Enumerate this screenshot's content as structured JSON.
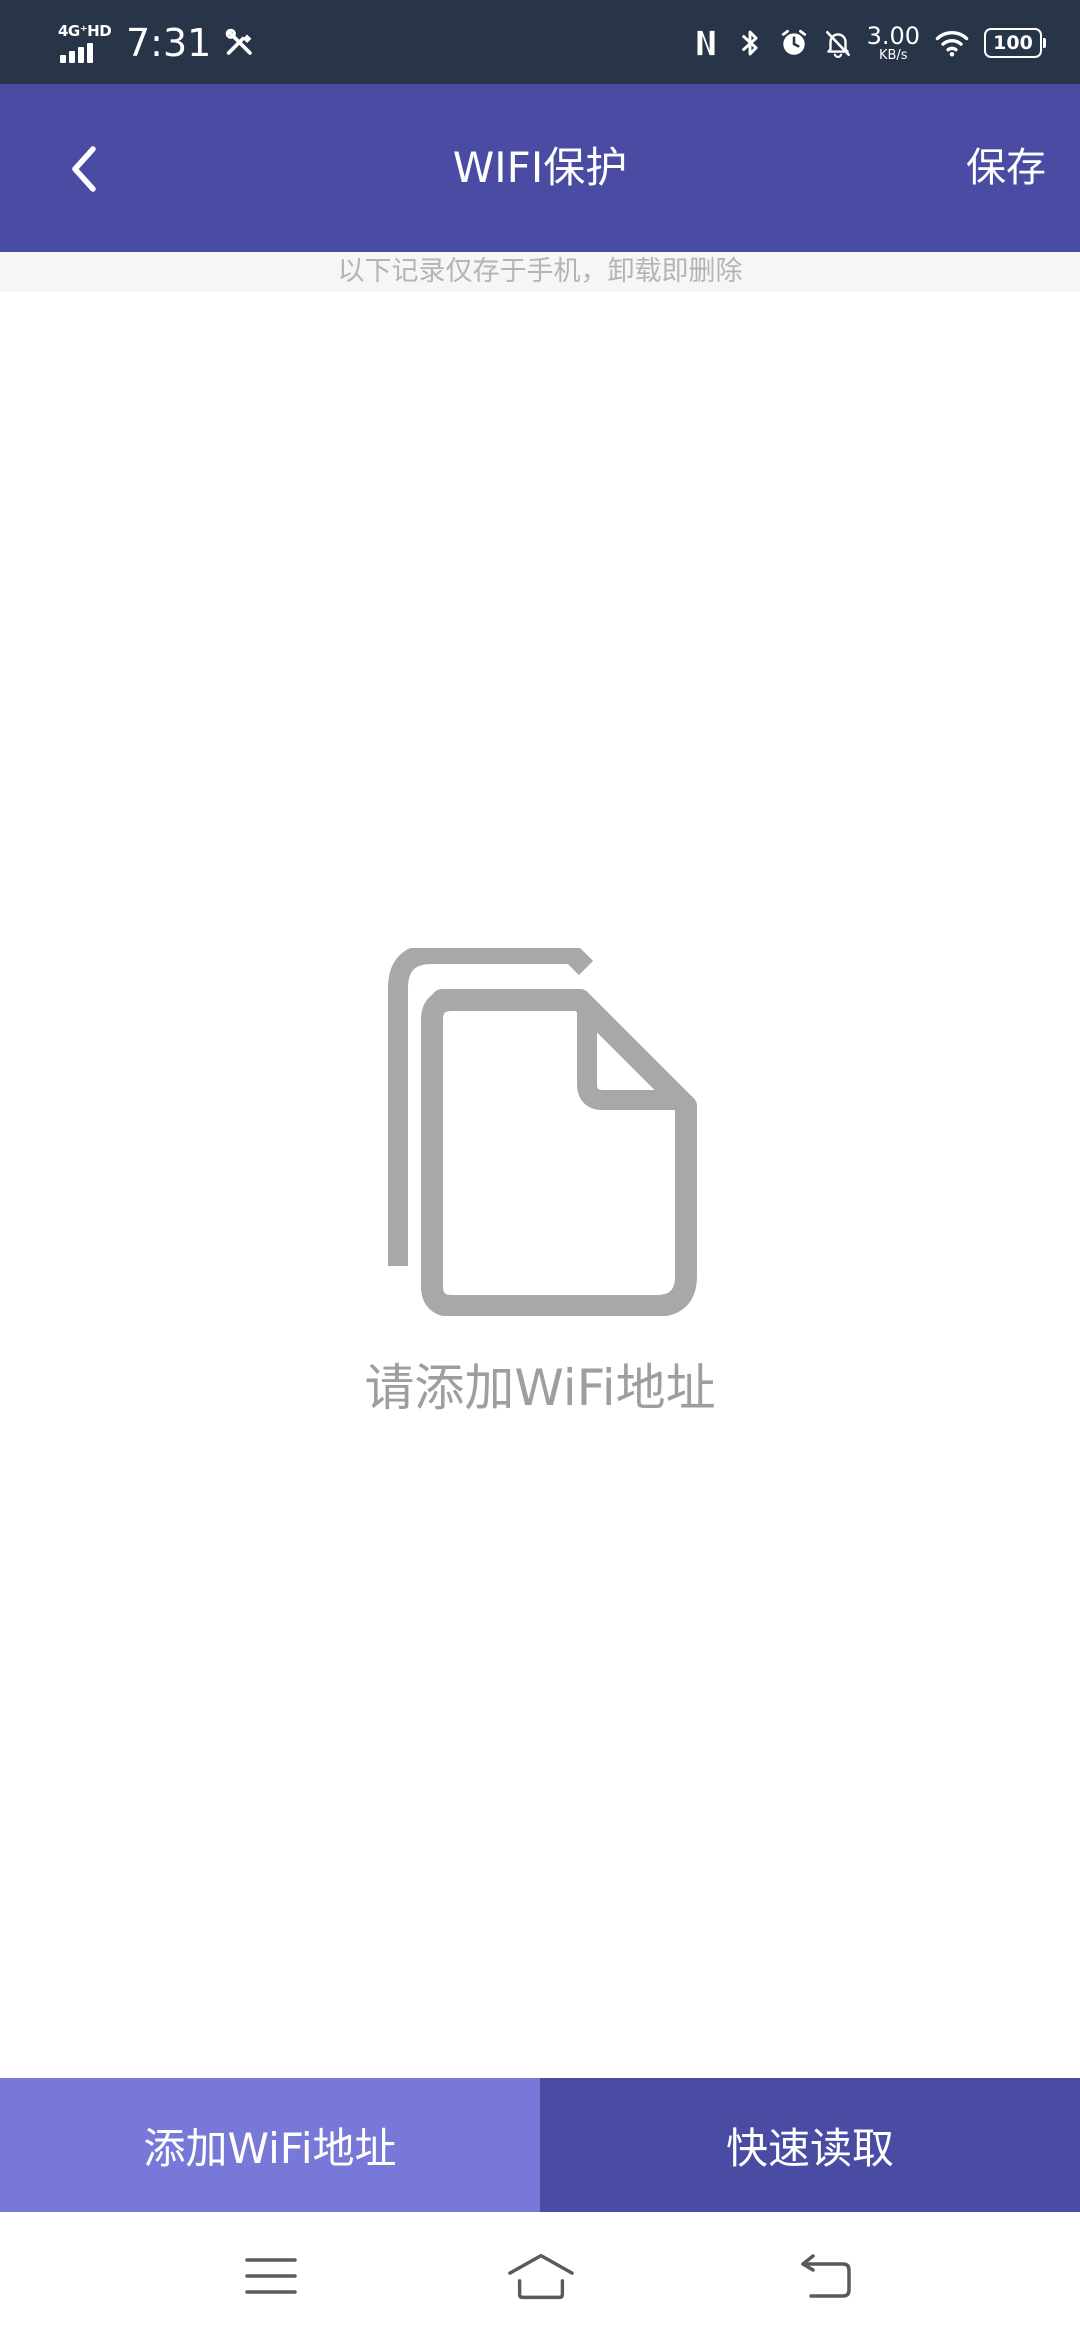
{
  "status_bar": {
    "network": "4G⁺HD",
    "time": "7:31",
    "speed_value": "3.00",
    "speed_unit": "KB/s",
    "battery": "100",
    "icons": [
      "nfc-icon",
      "bluetooth-icon",
      "alarm-icon",
      "notifications-off-icon",
      "wifi-icon",
      "battery-icon"
    ]
  },
  "app_bar": {
    "title": "WIFI保护",
    "save_label": "保存",
    "back_icon": "chevron-left-icon"
  },
  "notice": "以下记录仅存于手机，卸载即删除",
  "empty_state": {
    "icon": "documents-icon",
    "text": "请添加WiFi地址"
  },
  "actions": {
    "add_wifi_label": "添加WiFi地址",
    "quick_read_label": "快速读取"
  },
  "nav_bar": {
    "icons": [
      "menu-icon",
      "home-icon",
      "back-icon"
    ]
  },
  "colors": {
    "status_bar_bg": "#283548",
    "app_bar_bg": "#4a4ba3",
    "add_button_bg": "#7878d8",
    "quick_read_bg": "#4a4ba3",
    "empty_gray": "#9e9e9e"
  }
}
